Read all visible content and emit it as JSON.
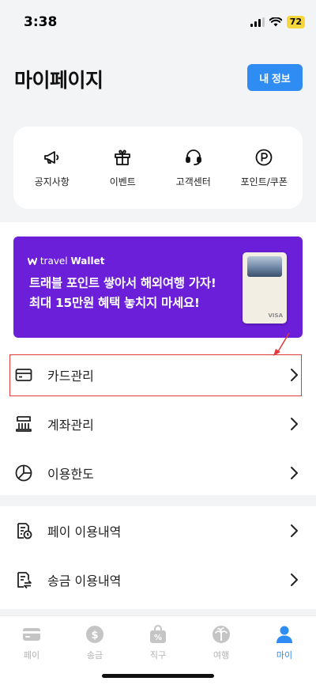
{
  "status": {
    "time": "3:38",
    "battery": "72"
  },
  "header": {
    "title": "마이페이지",
    "my_info_button": "내 정보"
  },
  "quick_menu": [
    {
      "label": "공지사항",
      "icon": "megaphone-icon"
    },
    {
      "label": "이벤트",
      "icon": "gift-icon"
    },
    {
      "label": "고객센터",
      "icon": "headset-icon"
    },
    {
      "label": "포인트/쿠폰",
      "icon": "point-icon"
    }
  ],
  "banner": {
    "brand_prefix": "travel",
    "brand_name": "Wallet",
    "line1": "트래블 포인트 쌓아서 해외여행 가자!",
    "line2": "최대 15만원 혜택 놓치지 마세요!",
    "card_brand": "VISA",
    "background": "#6b1fd8"
  },
  "menu": [
    {
      "label": "카드관리",
      "icon": "card-icon"
    },
    {
      "label": "계좌관리",
      "icon": "bank-icon"
    },
    {
      "label": "이용한도",
      "icon": "pie-chart-icon"
    }
  ],
  "history_menu": [
    {
      "label": "페이 이용내역",
      "icon": "pay-history-icon"
    },
    {
      "label": "송금 이용내역",
      "icon": "transfer-history-icon"
    }
  ],
  "bottom_nav": [
    {
      "label": "페이",
      "icon": "wallet-icon",
      "active": false
    },
    {
      "label": "송금",
      "icon": "coin-icon",
      "active": false
    },
    {
      "label": "직구",
      "icon": "shopping-bag-icon",
      "active": false
    },
    {
      "label": "여행",
      "icon": "palm-tree-icon",
      "active": false
    },
    {
      "label": "마이",
      "icon": "person-icon",
      "active": true
    }
  ],
  "colors": {
    "accent": "#2f8cf3",
    "highlight": "#e23b3b",
    "inactive": "#b1b1b1"
  }
}
